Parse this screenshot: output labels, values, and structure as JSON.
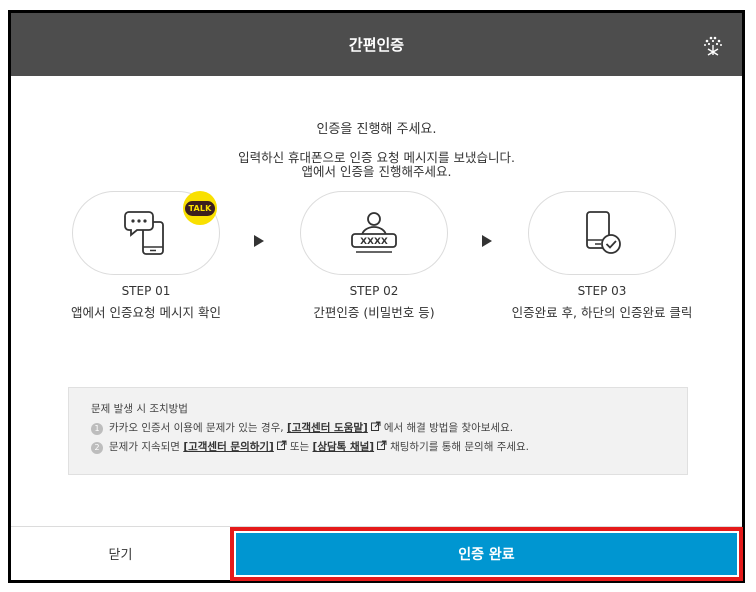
{
  "dialog": {
    "title": "간편인증",
    "close_icon": "tree-close-icon"
  },
  "intro": {
    "line1": "인증을 진행해 주세요.",
    "line2": "입력하신 휴대폰으로 인증 요청 메시지를 보냈습니다.",
    "line3": "앱에서 인증을 진행해주세요."
  },
  "badge": {
    "label": "TALK",
    "icon": "kakaotalk-badge-icon"
  },
  "steps": [
    {
      "num": "STEP 01",
      "desc": "앱에서 인증요청 메시지 확인",
      "icon": "phone-message-icon"
    },
    {
      "num": "STEP 02",
      "desc": "간편인증 (비밀번호 등)",
      "icon": "user-password-icon"
    },
    {
      "num": "STEP 03",
      "desc": "인증완료 후, 하단의 인증완료 클릭",
      "icon": "phone-check-icon"
    }
  ],
  "help": {
    "heading": "문제 발생 시 조치방법",
    "item1": {
      "badge": "1",
      "pre": "카카오 인증서 이용에 문제가 있는 경우,",
      "link": "[고객센터 도움말]",
      "post": "에서 해결 방법을 찾아보세요."
    },
    "item2": {
      "badge": "2",
      "pre": "문제가 지속되면",
      "link1": "[고객센터 문의하기]",
      "mid": "또는",
      "link2": "[상담톡 채널]",
      "post": "채팅하기를 통해 문의해 주세요."
    }
  },
  "footer": {
    "close_label": "닫기",
    "confirm_label": "인증 완료"
  },
  "colors": {
    "titlebar": "#4d4d4d",
    "confirm": "#0096d1",
    "highlight": "#e51a1a",
    "talk": "#f9e000"
  }
}
